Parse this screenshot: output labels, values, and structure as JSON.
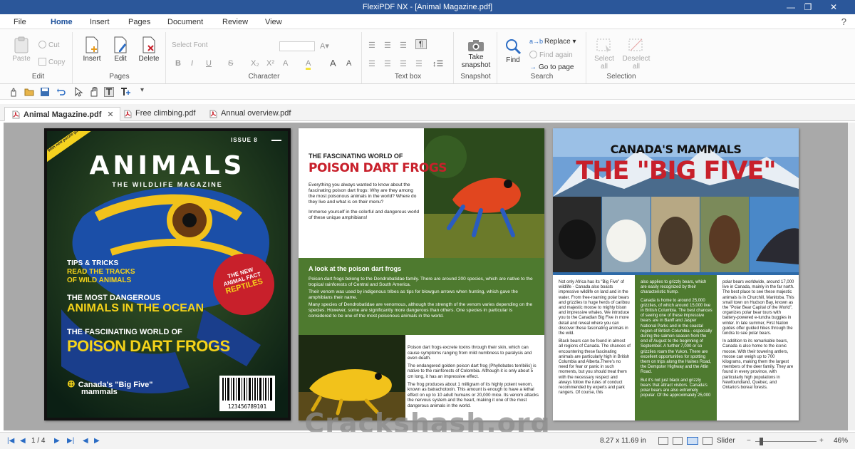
{
  "app": {
    "title": "FlexiPDF NX - [Animal Magazine.pdf]",
    "help": "?"
  },
  "menu": [
    "File",
    "Home",
    "Insert",
    "Pages",
    "Document",
    "Review",
    "View"
  ],
  "ribbon": {
    "edit": {
      "paste": "Paste",
      "cut": "Cut",
      "copy": "Copy",
      "label": "Edit"
    },
    "pages": {
      "insert": "Insert",
      "edit": "Edit",
      "delete": "Delete",
      "label": "Pages"
    },
    "character": {
      "font_placeholder": "Select Font",
      "label": "Character",
      "buttons": [
        "B",
        "I",
        "U",
        "S",
        "X₂",
        "X²",
        "A",
        "A",
        "A",
        "A"
      ]
    },
    "textbox": {
      "label": "Text box",
      "pilcrow": "¶"
    },
    "snapshot": {
      "button": "Take snapshot",
      "label": "Snapshot"
    },
    "search": {
      "find": "Find",
      "replace": "Replace",
      "find_again": "Find again",
      "goto": "Go to page",
      "label": "Search"
    },
    "selection": {
      "select_all": "Select all",
      "deselect_all": "Deselect all",
      "label": "Selection"
    }
  },
  "tabs": [
    {
      "label": "Animal Magazine.pdf",
      "active": true,
      "close": "✕"
    },
    {
      "label": "Free climbing.pdf",
      "active": false
    },
    {
      "label": "Annual overview.pdf",
      "active": false
    }
  ],
  "cover": {
    "issue": "ISSUE 8",
    "badge": "With new puzzle game",
    "title": "ANIMALS",
    "subtitle": "THE WILDLIFE MAGAZINE",
    "tips_1": "TIPS & TRICKS",
    "tips_2": "READ THE TRACKS",
    "tips_3": "OF WILD ANIMALS",
    "dangerous_1": "THE MOST DANGEROUS",
    "dangerous_2": "ANIMALS IN THE OCEAN",
    "frogs_1": "THE FASCINATING WORLD OF",
    "frogs_2": "POISON DART FROGS",
    "canada_1": "Canada's \"Big Five\"",
    "canada_2": "mammals",
    "circle_1": "THE NEW",
    "circle_2": "ANIMAL FACT",
    "circle_3": "REPTILES",
    "barcode": "123456789101"
  },
  "middle": {
    "kicker": "THE FASCINATING WORLD OF",
    "headline": "POISON DART FROGS",
    "intro_1": "Everything you always wanted to know about the fascinating poison dart frogs: Why are they among the most poisonous animals in the world? Where do they live and what is on their menu?",
    "intro_2": "Immerse yourself in the colorful and dangerous world of these unique amphibians!",
    "green_head": "A look at the poison dart frogs",
    "green_1": "Poison dart frogs belong to the Dendrobatidae family. There are around 200 species, which are native to the tropical rainforests of Central and South America.",
    "green_2": "Their venom was used by indigenous tribes as tips for blowgun arrows when hunting, which gave the amphibians their name.",
    "green_3": "Many species of Dendrobatidae are venomous, although the strength of the venom varies depending on the species. However, some are significantly more dangerous than others. One species in particular is considered to be one of the most poisonous animals in the world.",
    "body_1": "Poison dart frogs excrete toxins through their skin, which can cause symptoms ranging from mild numbness to paralysis and even death.",
    "body_2": "The endangered golden poison dart frog (Phyllobates terribilis) is native to the rainforests of Colombia. Although it is only about 5 cm long, it has an impressive effect.",
    "body_3": "The frog produces about 1 milligram of its highly potent venom, known as batrachotoxin. This amount is enough to have a lethal effect on up to 10 adult humans or 20,000 mice. Its venom attacks the nervous system and the heart, making it one of the most dangerous animals in the world."
  },
  "right": {
    "kicker": "CANADA'S MAMMALS",
    "headline": "THE \"BIG FIVE\"",
    "col1_1": "Not only Africa has its \"Big Five\" of wildlife - Canada also boasts impressive wildlife on land and in the water. From free-roaming polar bears and grizzlies to huge herds of caribou and majestic moose to mighty bison and impressive whales. We introduce you to the Canadian Big Five in more detail and reveal where you can discover these fascinating animals in the wild.",
    "col1_2": "Black bears can be found in almost all regions of Canada. The chances of encountering these fascinating animals are particularly high in British Columbia and Alberta.There's no need for fear or panic in such moments, but you should treat them with the necessary respect and always follow the rules of conduct recommended by experts and park rangers. Of course, this",
    "col2_1": "also applies to grizzly bears, which are easily recognized by their characteristic hump.",
    "col2_2": "Canada is home to around 25,000 grizzlies, of which around 15,000 live in British Columbia. The best chances of seeing one of these impressive bears are in Banff and Jasper National Parks and in the coastal region of British Columbia - especially during the salmon season from the end of August to the beginning of September. A further 7,000 or so grizzlies roam the Yukon. There are excellent opportunities for spotting them on trips along the Haines Road, the Dempster Highway and the Atlin Road.",
    "col2_3": "But it's not just black and grizzly bears that attract visitors. Canada's polar bears are also extremely popular. Of the approximately 25,000",
    "col3_1": "polar bears worldwide, around 17,000 live in Canada, mainly in the far north. The best place to see these majestic animals is in Churchill, Manitoba. This small town on Hudson Bay, known as the \"Polar Bear Capital of the World\", organizes polar bear tours with battery-powered e-tundra buggies in winter. In late summer, First Nation guides offer guided hikes through the tundra to see polar bears.",
    "col3_2": "In addition to its remarkable bears, Canada is also home to the iconic moose. With their towering antlers, moose can weigh up to 700 kilograms, making them the largest members of the deer family. They are found in every province, with particularly high populations in Newfoundland, Quebec, and Ontario's boreal forests."
  },
  "status": {
    "page": "1 / 4",
    "size": "8.27 x 11.69 in",
    "slider": "Slider",
    "zoom": "46%"
  },
  "watermark": "Crackshash.org",
  "colors": {
    "accent": "#2b579a",
    "headline_red": "#c8202b",
    "green": "#4e7a2f",
    "yellow": "#f5d31a"
  }
}
